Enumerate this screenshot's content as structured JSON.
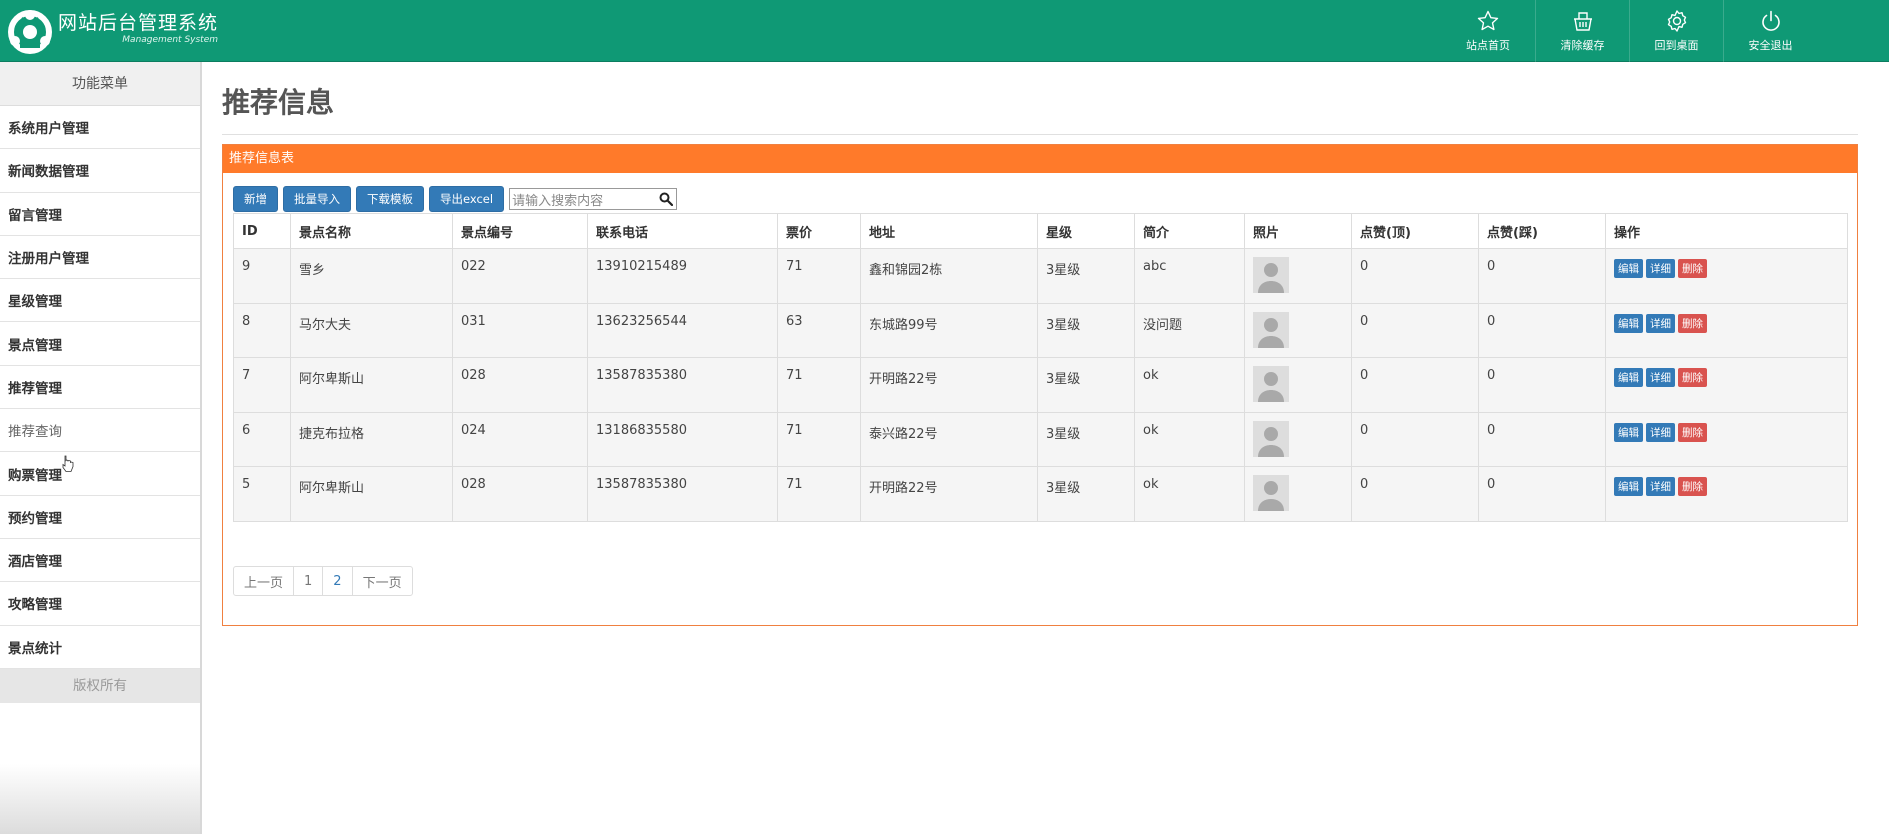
{
  "header": {
    "title": "网站后台管理系统",
    "subtitle": "Management System",
    "buttons": [
      {
        "label": "站点首页",
        "icon": "star-icon"
      },
      {
        "label": "清除缓存",
        "icon": "basket-icon"
      },
      {
        "label": "回到桌面",
        "icon": "gear-icon"
      },
      {
        "label": "安全退出",
        "icon": "power-icon"
      }
    ]
  },
  "sidebar": {
    "title": "功能菜单",
    "items": [
      {
        "label": "系统用户管理"
      },
      {
        "label": "新闻数据管理"
      },
      {
        "label": "留言管理"
      },
      {
        "label": "注册用户管理"
      },
      {
        "label": "星级管理"
      },
      {
        "label": "景点管理"
      },
      {
        "label": "推荐管理"
      },
      {
        "label": "推荐查询"
      },
      {
        "label": "购票管理"
      },
      {
        "label": "预约管理"
      },
      {
        "label": "酒店管理"
      },
      {
        "label": "攻略管理"
      },
      {
        "label": "景点统计"
      }
    ],
    "footer": "版权所有"
  },
  "main": {
    "page_title": "推荐信息",
    "panel_title": "推荐信息表",
    "actions": {
      "add": "新增",
      "batch_import": "批量导入",
      "download_template": "下载模板",
      "export_excel": "导出excel"
    },
    "search": {
      "placeholder": "请输入搜索内容"
    },
    "table": {
      "columns": [
        "ID",
        "景点名称",
        "景点编号",
        "联系电话",
        "票价",
        "地址",
        "星级",
        "简介",
        "照片",
        "点赞(顶)",
        "点赞(踩)",
        "操作"
      ],
      "rows": [
        {
          "id": "9",
          "name": "雪乡",
          "code": "022",
          "phone": "13910215489",
          "price": "71",
          "address": "鑫和锦园2栋",
          "star": "3星级",
          "intro": "abc",
          "likes": "0",
          "dislikes": "0"
        },
        {
          "id": "8",
          "name": "马尔大夫",
          "code": "031",
          "phone": "13623256544",
          "price": "63",
          "address": "东城路99号",
          "star": "3星级",
          "intro": "没问题",
          "likes": "0",
          "dislikes": "0"
        },
        {
          "id": "7",
          "name": "阿尔卑斯山",
          "code": "028",
          "phone": "13587835380",
          "price": "71",
          "address": "开明路22号",
          "star": "3星级",
          "intro": "ok",
          "likes": "0",
          "dislikes": "0"
        },
        {
          "id": "6",
          "name": "捷克布拉格",
          "code": "024",
          "phone": "13186835580",
          "price": "71",
          "address": "泰兴路22号",
          "star": "3星级",
          "intro": "ok",
          "likes": "0",
          "dislikes": "0"
        },
        {
          "id": "5",
          "name": "阿尔卑斯山",
          "code": "028",
          "phone": "13587835380",
          "price": "71",
          "address": "开明路22号",
          "star": "3星级",
          "intro": "ok",
          "likes": "0",
          "dislikes": "0"
        }
      ],
      "row_actions": {
        "edit": "编辑",
        "detail": "详细",
        "delete": "删除"
      }
    },
    "pagination": {
      "prev": "上一页",
      "pages": [
        "1",
        "2"
      ],
      "next": "下一页"
    }
  }
}
